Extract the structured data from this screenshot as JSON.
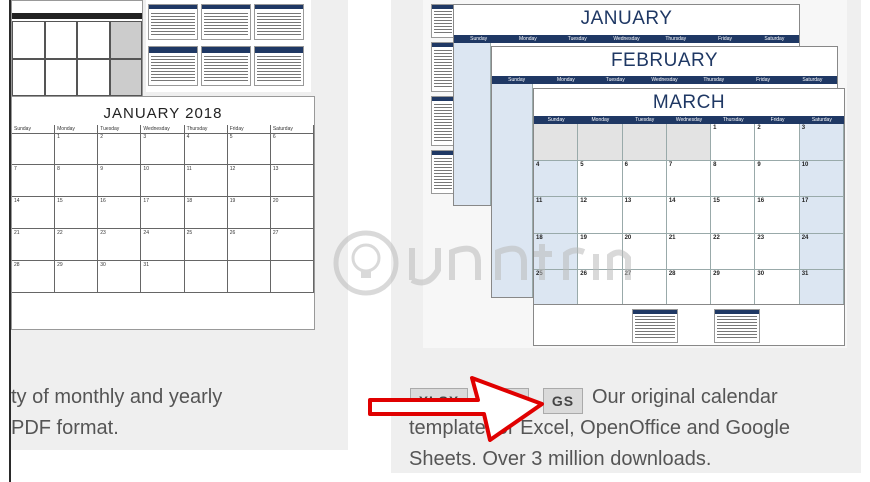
{
  "left_card": {
    "title": "JANUARY 2018",
    "weekdays": [
      "Sunday",
      "Monday",
      "Tuesday",
      "Wednesday",
      "Thursday",
      "Friday",
      "Saturday"
    ],
    "days": [
      "",
      "1",
      "2",
      "3",
      "4",
      "5",
      "6",
      "7",
      "8",
      "9",
      "10",
      "11",
      "12",
      "13",
      "14",
      "15",
      "16",
      "17",
      "18",
      "19",
      "20",
      "21",
      "22",
      "23",
      "24",
      "25",
      "26",
      "27",
      "28",
      "29",
      "30",
      "31",
      "",
      "",
      ""
    ],
    "description_line1": "ty of monthly and yearly",
    "description_line2": "PDF format."
  },
  "right_card": {
    "january_title": "JANUARY",
    "february_title": "FEBRUARY",
    "march_title": "MARCH",
    "weekdays": [
      "Sunday",
      "Monday",
      "Tuesday",
      "Wednesday",
      "Thursday",
      "Friday",
      "Saturday"
    ],
    "march_days": [
      "",
      "",
      "",
      "",
      "1",
      "2",
      "3",
      "4",
      "5",
      "6",
      "7",
      "8",
      "9",
      "10",
      "11",
      "12",
      "13",
      "14",
      "15",
      "16",
      "17",
      "18",
      "19",
      "20",
      "21",
      "22",
      "23",
      "24",
      "25",
      "26",
      "27",
      "28",
      "29",
      "30",
      "31"
    ],
    "buttons": {
      "xlsx": "XLSX",
      "ods": "ODS",
      "gs": "GS"
    },
    "description_line1": "Our original calendar",
    "description_line2": "template for Excel, OpenOffice and Google",
    "description_line3": "Sheets. Over 3 million downloads."
  },
  "colors": {
    "navy": "#1f3864",
    "arrow": "#e00000",
    "card_bg": "#efefef"
  },
  "icons": {
    "arrow": "red-arrow-icon",
    "watermark": "bulb-logo-icon"
  }
}
